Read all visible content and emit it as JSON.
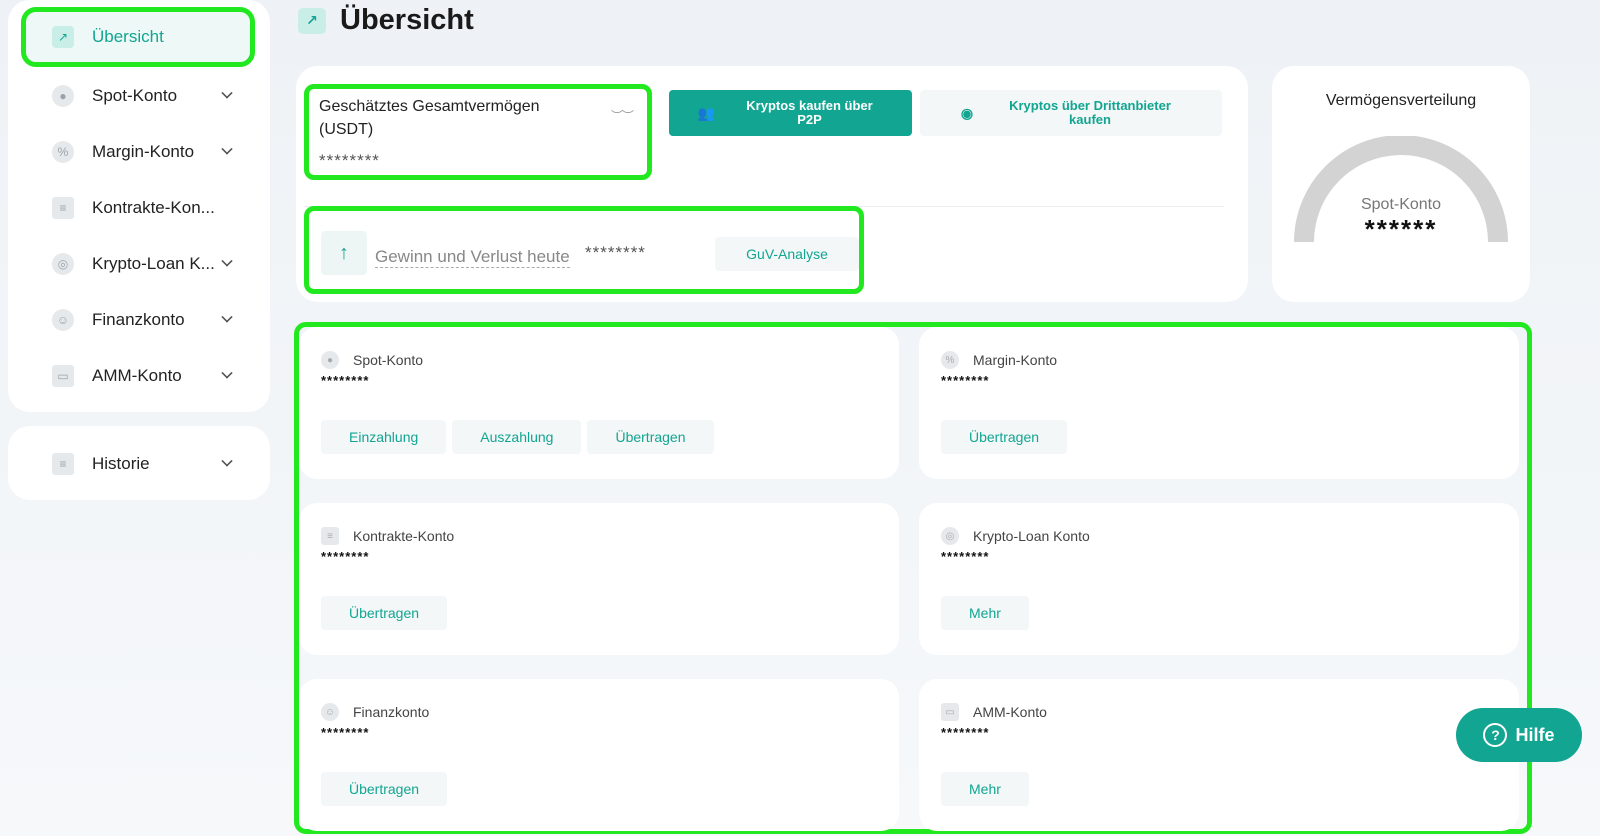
{
  "sidebar": {
    "items": [
      {
        "label": "Übersicht",
        "icon": "chart-icon"
      },
      {
        "label": "Spot-Konto",
        "icon": "coin-icon"
      },
      {
        "label": "Margin-Konto",
        "icon": "percent-icon"
      },
      {
        "label": "Kontrakte-Kon...",
        "icon": "document-icon"
      },
      {
        "label": "Krypto-Loan K...",
        "icon": "loan-icon"
      },
      {
        "label": "Finanzkonto",
        "icon": "person-icon"
      },
      {
        "label": "AMM-Konto",
        "icon": "amm-icon"
      }
    ],
    "history": {
      "label": "Historie",
      "icon": "history-icon"
    }
  },
  "header": {
    "title": "Übersicht"
  },
  "summary": {
    "estimated_title": "Geschätztes Gesamtvermögen (USDT)",
    "estimated_value": "********",
    "btn_p2p": "Kryptos kaufen über P2P",
    "btn_third": "Kryptos über Drittanbieter kaufen",
    "pnl_label": "Gewinn und Verlust heute",
    "pnl_value": "********",
    "btn_guv": "GuV-Analyse"
  },
  "distribution": {
    "title": "Vermögensverteilung",
    "label": "Spot-Konto",
    "value": "******"
  },
  "accounts": [
    {
      "name": "Spot-Konto",
      "value": "********",
      "buttons": [
        "Einzahlung",
        "Auszahlung",
        "Übertragen"
      ]
    },
    {
      "name": "Margin-Konto",
      "value": "********",
      "buttons": [
        "Übertragen"
      ]
    },
    {
      "name": "Kontrakte-Konto",
      "value": "********",
      "buttons": [
        "Übertragen"
      ]
    },
    {
      "name": "Krypto-Loan Konto",
      "value": "********",
      "buttons": [
        "Mehr"
      ]
    },
    {
      "name": "Finanzkonto",
      "value": "********",
      "buttons": [
        "Übertragen"
      ]
    },
    {
      "name": "AMM-Konto",
      "value": "********",
      "buttons": [
        "Mehr"
      ]
    }
  ],
  "help": {
    "label": "Hilfe"
  },
  "colors": {
    "accent": "#12a591",
    "highlight": "#22e81f"
  }
}
